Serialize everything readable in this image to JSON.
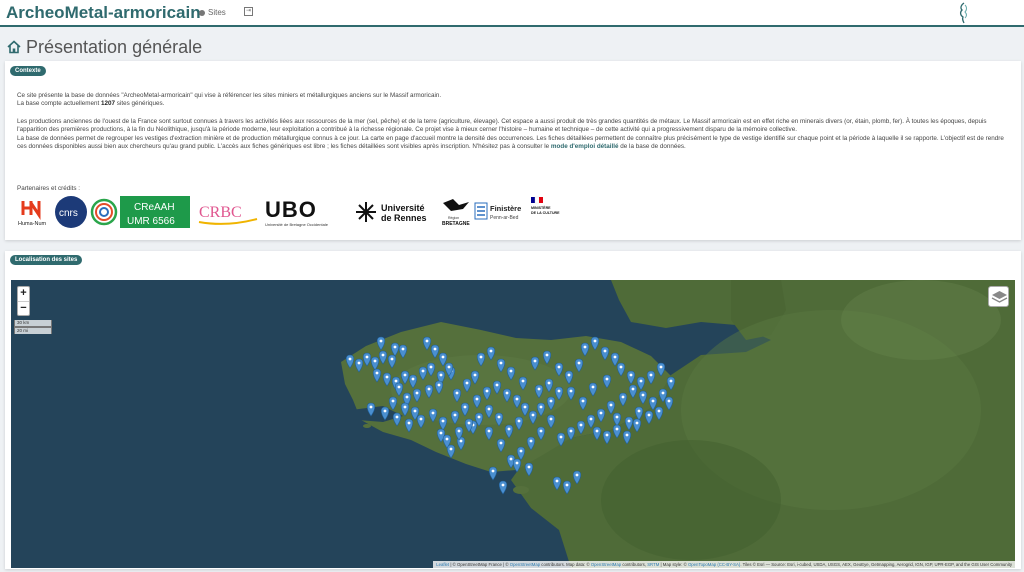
{
  "header": {
    "brand": "ArcheoMetal-armoricain",
    "nav_sites": "Sites"
  },
  "page": {
    "title": "Présentation générale"
  },
  "context": {
    "badge": "Contexte",
    "p1": "Ce site présente la base de données \"ArcheoMetal-armoricain\" qui vise à référencer les sites miniers et métallurgiques anciens sur le Massif armoricain.",
    "p2_before": "La base compte actuellement ",
    "site_count": "1207",
    "p2_after": " sites génériques.",
    "p3": "Les productions anciennes de l'ouest de la France sont surtout connues à travers les activités liées aux ressources de la mer (sel, pêche) et de la terre (agriculture, élevage). Cet espace a aussi produit de très grandes quantités de métaux. Le Massif armoricain est en effet riche en minerais divers (or, étain, plomb, fer). À toutes les époques, depuis l'apparition des premières productions, à la fin du Néolithique, jusqu'à la période moderne, leur exploitation a contribué à la richesse régionale. Ce projet vise à mieux cerner l'histoire – humaine et technique – de cette activité qui a progressivement disparu de la mémoire collective.",
    "p4_before": "La base de données permet de regrouper les vestiges d'extraction minière et de production métallurgique connus à ce jour. La carte en page d'accueil montre la densité des occurrences. Les fiches détaillées permettent de connaître plus précisément le type de vestige identifié sur chaque point et la période à laquelle il se rapporte. L'objectif est de rendre ces données disponibles aussi bien aux chercheurs qu'au grand public. L'accès aux fiches génériques est libre ; les fiches détaillées sont visibles après inscription. N'hésitez pas à consulter le ",
    "p4_link": "mode d'emploi détaillé",
    "p4_after": " de la base de données.",
    "partners_label": "Partenaires et crédits :",
    "logos": {
      "humanum": "Huma-Num",
      "cnrs": "cnrs",
      "creaah_1": "CReAAH",
      "creaah_2": "UMR 6566",
      "crbc": "CRBC",
      "ubo": "UBO",
      "ubo_sub": "Université de Bretagne Occidentale",
      "rennes_1": "Université",
      "rennes_2": "de Rennes",
      "bretagne_1": "Région",
      "bretagne_2": "BRETAGNE",
      "finistere_1": "Finistère",
      "finistere_2": "Penn-ar-Bed",
      "ministere_1": "MINISTÈRE",
      "ministere_2": "DE LA CULTURE"
    }
  },
  "map_section": {
    "badge": "Localisation des sites",
    "zoom_in": "+",
    "zoom_out": "−",
    "scale_km": "30 km",
    "scale_mi": "20 mi",
    "attr_leaflet": "Leaflet",
    "attr_osm_fr": " | © OpenStreetMap France | © ",
    "attr_osm": "OpenStreetMap",
    "attr_contrib": " contributors. Map data: © ",
    "attr_osm2": "OpenStreetMap",
    "attr_sep": " contributors, ",
    "attr_srtm": "SRTM",
    "attr_style": " | Map style: © ",
    "attr_otm": "OpenTopoMap (CC-BY-SA)",
    "attr_esri": ". Tiles © Esri — Source: Esri, i-cubed, USDA, USGS, AEX, GeoEye, Getmapping, Aerogrid, IGN, IGP, UPR-EGP, and the GIS User Community",
    "colors": {
      "marker": "#4a8fd0",
      "sea": "#24445a",
      "land": "#4f6b38"
    }
  }
}
